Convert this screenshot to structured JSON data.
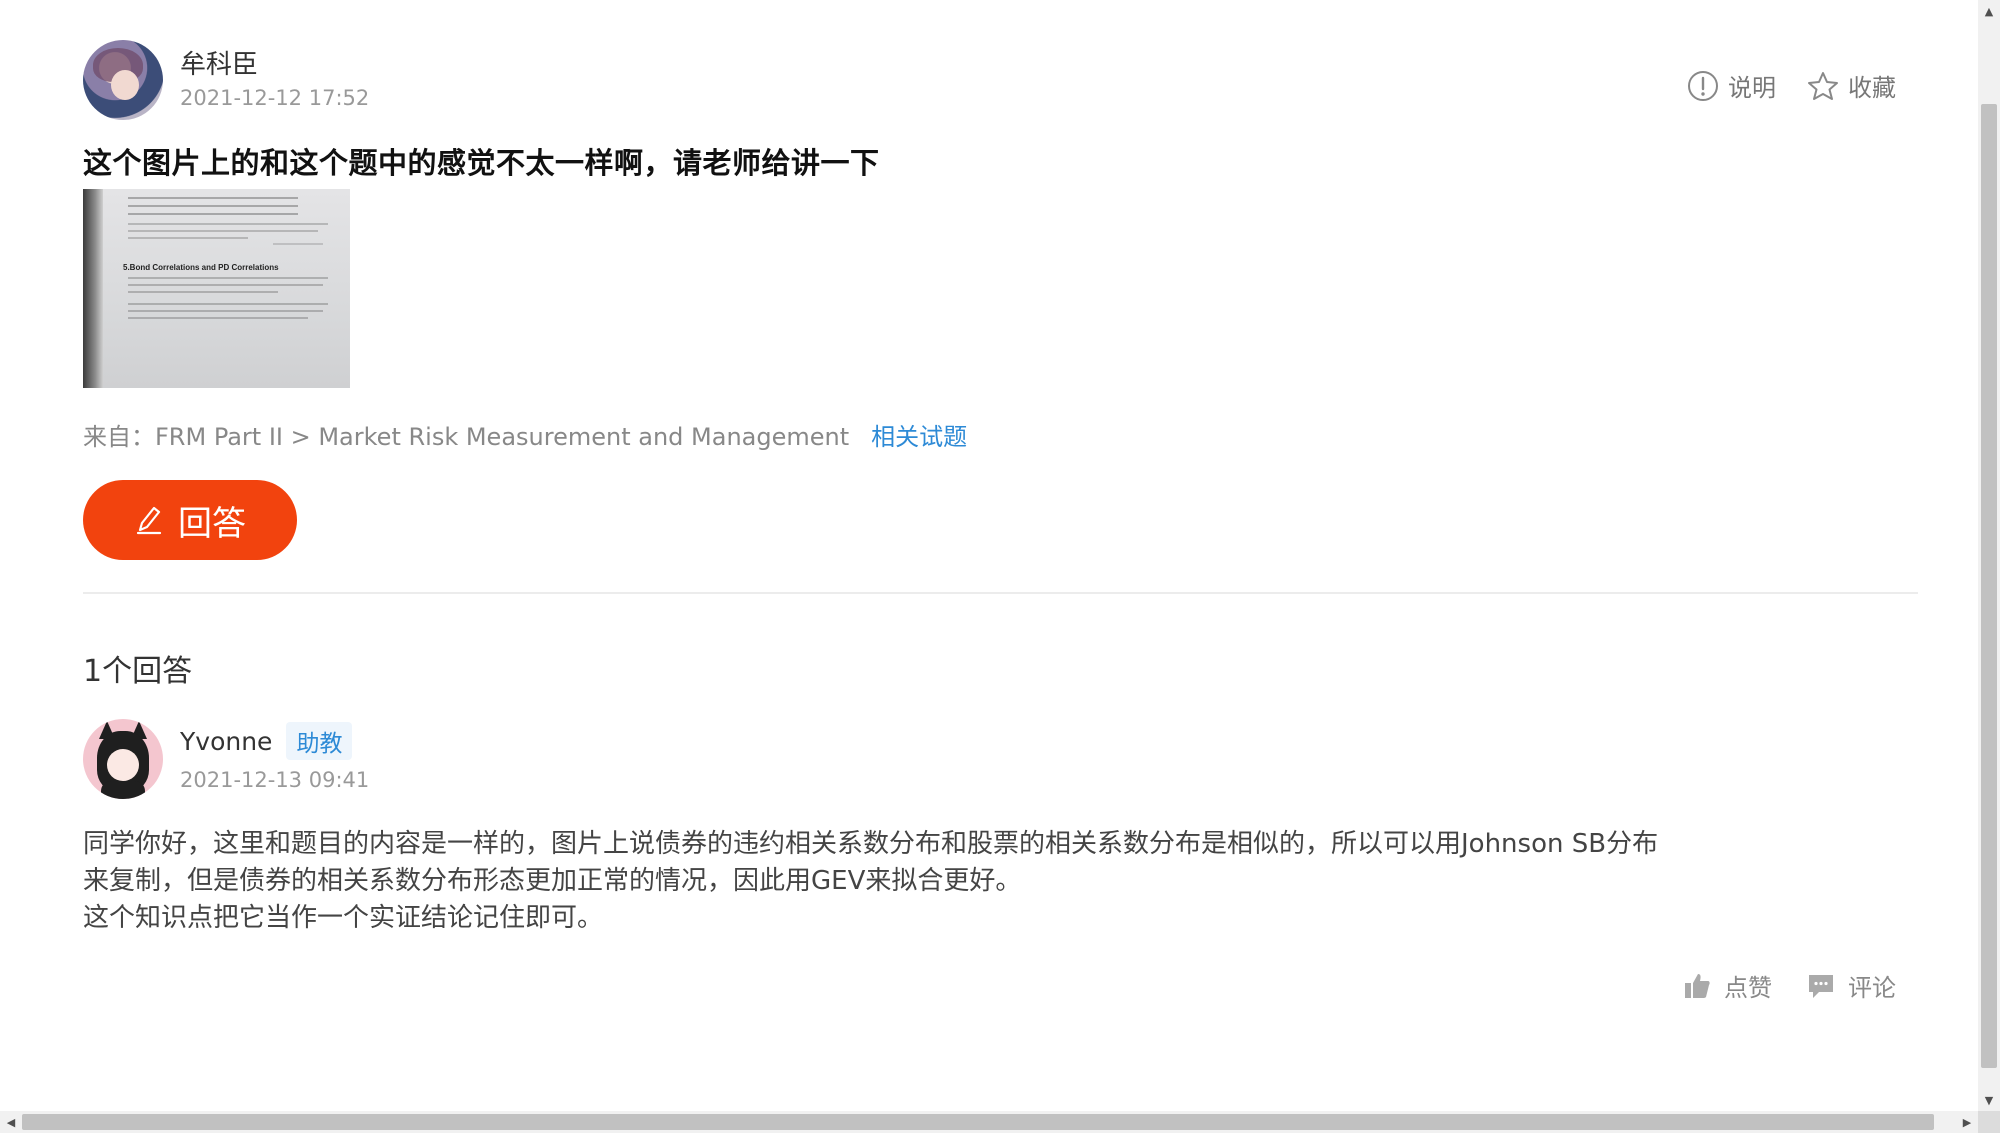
{
  "question": {
    "author": "牟科臣",
    "time": "2021-12-12 17:52",
    "title": "这个图片上的和这个题中的感觉不太一样啊，请老师给讲一下",
    "image_heading": "5.Bond Correlations and PD Correlations",
    "source_label": "来自：",
    "source_path": "FRM Part II > Market Risk Measurement and Management",
    "related_link": "相关试题",
    "answer_button": "回答"
  },
  "top_actions": {
    "info_label": "说明",
    "favorite_label": "收藏"
  },
  "answers_header": "1个回答",
  "answer": {
    "author": "Yvonne",
    "badge": "助教",
    "time": "2021-12-13 09:41",
    "lines": [
      "同学你好，这里和题目的内容是一样的，图片上说债券的违约相关系数分布和股票的相关系数分布是相似的，所以可以用Johnson SB分布",
      "来复制，但是债券的相关系数分布形态更加正常的情况，因此用GEV来拟合更好。",
      "这个知识点把它当作一个实证结论记住即可。"
    ],
    "like_label": "点赞",
    "comment_label": "评论"
  },
  "colors": {
    "accent": "#f2430e",
    "link": "#2d8ad6",
    "muted": "#999999"
  },
  "icons": [
    "info-icon",
    "star-icon",
    "pencil-icon",
    "thumbs-up-icon",
    "comment-icon"
  ]
}
